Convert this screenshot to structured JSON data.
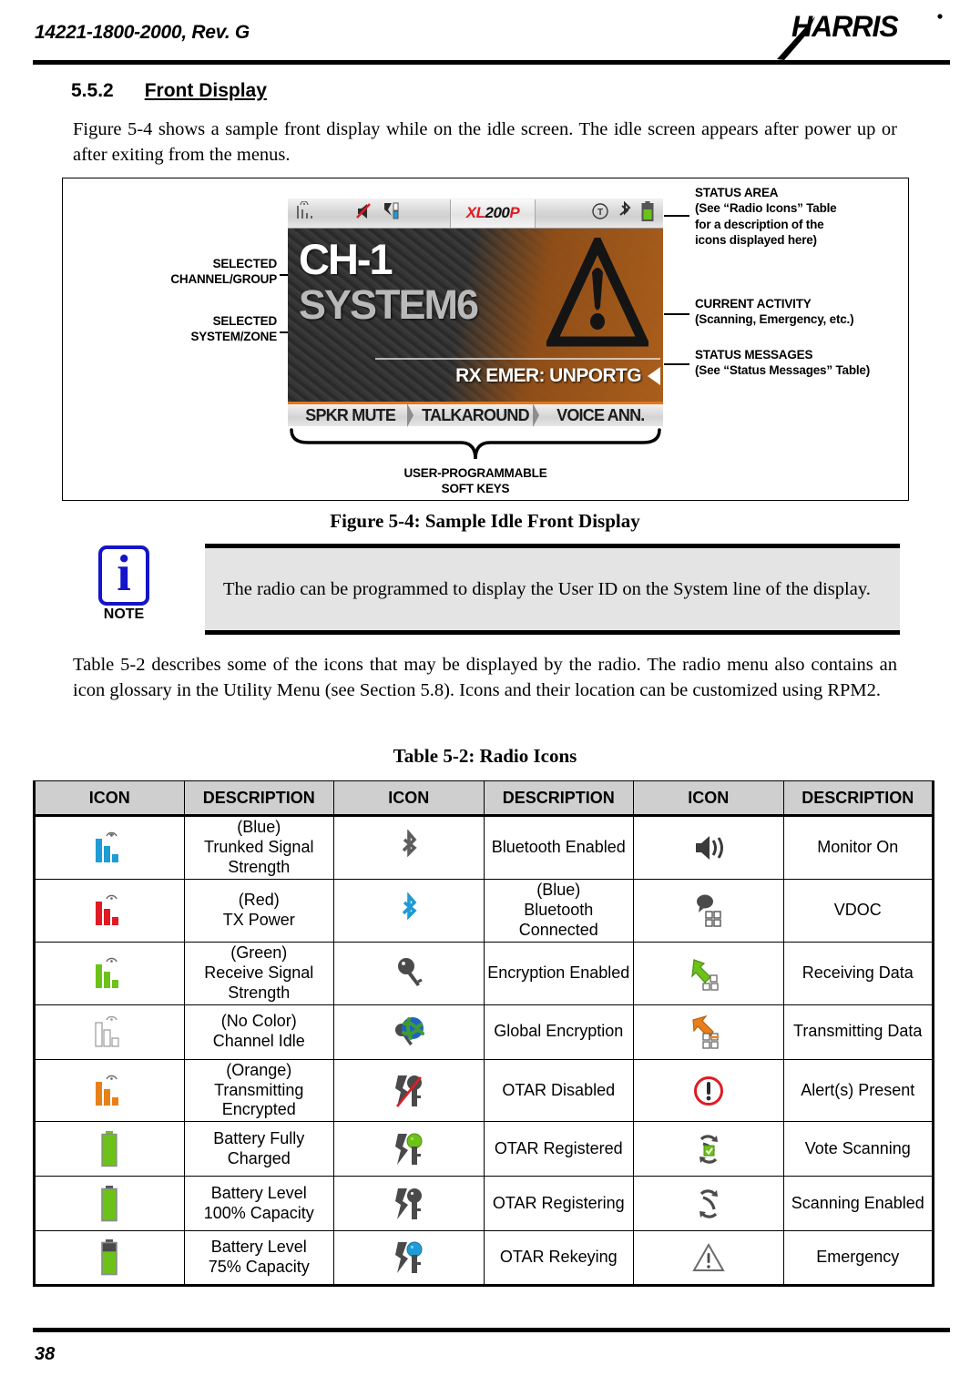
{
  "header": {
    "doc_id": "14221-1800-2000, Rev. G",
    "logo_text": "HARRIS"
  },
  "section": {
    "number": "5.5.2",
    "title": "Front Display"
  },
  "intro_paragraph": "Figure 5-4 shows a sample front display while on the idle screen.  The idle screen appears after power up or after exiting from the menus.",
  "figure": {
    "caption": "Figure 5-4: Sample Idle Front Display",
    "labels": {
      "selected_channel_group": "SELECTED\nCHANNEL/GROUP",
      "selected_system_zone": "SELECTED\nSYSTEM/ZONE",
      "status_area": "STATUS AREA\n(See “Radio Icons” Table\nfor a description of the\nicons displayed here)",
      "current_activity": "CURRENT ACTIVITY\n(Scanning, Emergency, etc.)",
      "status_messages": "STATUS MESSAGES\n(See “Status Messages” Table)",
      "soft_keys": "USER-PROGRAMMABLE\nSOFT KEYS"
    },
    "radio": {
      "brand_logo": "XL200P",
      "brand_parts": {
        "xl": "XL",
        "num": "200",
        "p": "P"
      },
      "channel": "CH-1",
      "system": "SYSTEM6",
      "status_message": "RX EMER: UNPORTG",
      "soft_keys": [
        "SPKR MUTE",
        "TALKAROUND",
        "VOICE ANN."
      ],
      "status_icons_left": [
        "signal-bars-icon",
        "speaker-mute-icon",
        "vdoc-icon"
      ],
      "status_icons_right": [
        "t-circle-icon",
        "bluetooth-icon",
        "battery-icon"
      ],
      "activity_icon": "warning-triangle-icon"
    }
  },
  "note": {
    "word": "NOTE",
    "glyph": "i",
    "text": "The radio can be programmed to display the User ID on the System line of the display."
  },
  "table_intro_paragraph": "Table 5-2 describes some of the icons that may be displayed by the radio. The radio menu also contains an icon glossary in the Utility Menu (see Section 5.8).  Icons and their location can be customized using RPM2.",
  "table": {
    "caption": "Table 5-2: Radio Icons",
    "headers": [
      "ICON",
      "DESCRIPTION",
      "ICON",
      "DESCRIPTION",
      "ICON",
      "DESCRIPTION"
    ],
    "rows": [
      {
        "c1": {
          "icon": "signal-bars-blue-icon",
          "desc": "(Blue)\nTrunked Signal Strength"
        },
        "c2": {
          "icon": "bluetooth-gray-icon",
          "desc": "Bluetooth Enabled"
        },
        "c3": {
          "icon": "speaker-monitor-icon",
          "desc": "Monitor On"
        }
      },
      {
        "c1": {
          "icon": "signal-bars-red-icon",
          "desc": "(Red)\nTX Power"
        },
        "c2": {
          "icon": "bluetooth-blue-icon",
          "desc": "(Blue)\nBluetooth Connected"
        },
        "c3": {
          "icon": "vdoc-icon",
          "desc": "VDOC"
        }
      },
      {
        "c1": {
          "icon": "signal-bars-green-icon",
          "desc": "(Green)\nReceive Signal Strength"
        },
        "c2": {
          "icon": "key-gray-icon",
          "desc": "Encryption Enabled"
        },
        "c3": {
          "icon": "arrow-down-data-icon",
          "desc": "Receiving Data"
        }
      },
      {
        "c1": {
          "icon": "signal-bars-white-icon",
          "desc": "(No Color)\nChannel Idle"
        },
        "c2": {
          "icon": "key-globe-icon",
          "desc": "Global Encryption"
        },
        "c3": {
          "icon": "arrow-up-data-icon",
          "desc": "Transmitting Data"
        }
      },
      {
        "c1": {
          "icon": "signal-bars-orange-icon",
          "desc": "(Orange)\nTransmitting Encrypted"
        },
        "c2": {
          "icon": "otar-key-slash-icon",
          "desc": "OTAR Disabled"
        },
        "c3": {
          "icon": "alert-circle-icon",
          "desc": "Alert(s) Present"
        }
      },
      {
        "c1": {
          "icon": "battery-full-icon",
          "desc": "Battery Fully Charged"
        },
        "c2": {
          "icon": "otar-key-green-icon",
          "desc": "OTAR Registered"
        },
        "c3": {
          "icon": "scan-check-icon",
          "desc": "Vote Scanning"
        }
      },
      {
        "c1": {
          "icon": "battery-100-icon",
          "desc": "Battery Level\n100% Capacity"
        },
        "c2": {
          "icon": "otar-key-gray-icon",
          "desc": "OTAR Registering"
        },
        "c3": {
          "icon": "scan-icon",
          "desc": "Scanning Enabled"
        }
      },
      {
        "c1": {
          "icon": "battery-75-icon",
          "desc": "Battery Level\n75% Capacity"
        },
        "c2": {
          "icon": "otar-key-blue-icon",
          "desc": "OTAR Rekeying"
        },
        "c3": {
          "icon": "warning-triangle-outline-icon",
          "desc": "Emergency"
        }
      }
    ]
  },
  "footer": {
    "page_number": "38"
  },
  "colors": {
    "blue": "#1f9bd6",
    "red": "#e01b24",
    "green": "#6cc219",
    "orange": "#e8801a",
    "bluetooth_blue": "#1f9bd6",
    "note_blue": "#1414c8",
    "header_gray": "#cfcfcf"
  }
}
